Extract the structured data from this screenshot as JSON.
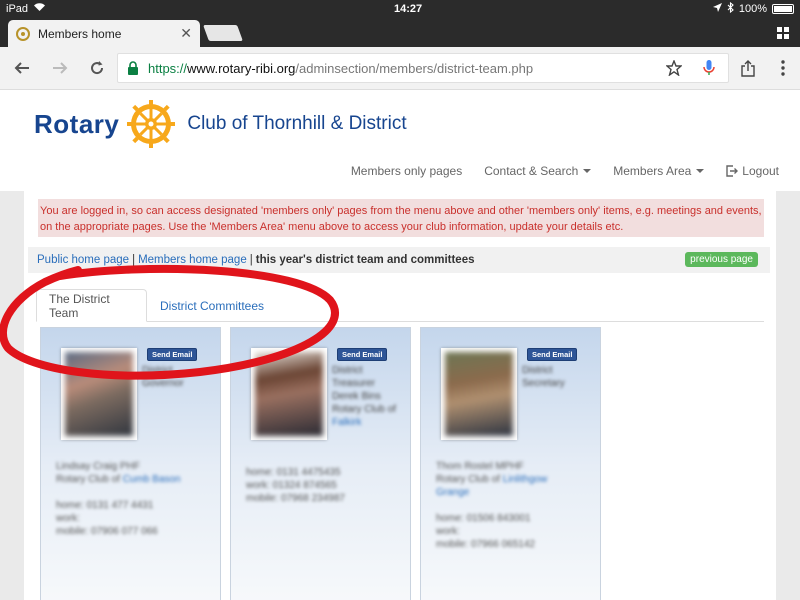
{
  "status_bar": {
    "device": "iPad",
    "time": "14:27",
    "battery": "100%",
    "battery_level": 1.0
  },
  "browser": {
    "tab_title": "Members home",
    "url": {
      "scheme": "https://",
      "host": "www.rotary-ribi.org",
      "path": "/adminsection/members/district-team.php"
    }
  },
  "site": {
    "logo_text": "Rotary",
    "club_name": "Club of Thornhill & District",
    "nav": {
      "members_only": "Members only pages",
      "contact": "Contact & Search",
      "members_area": "Members Area",
      "logout": "Logout"
    }
  },
  "alert": "You are logged in, so can access designated 'members only' pages from the menu above and other 'members only' items, e.g. meetings and events, on the appropriate pages. Use the 'Members Area' menu above to access your club information, update your details etc.",
  "breadcrumb": {
    "public_home": "Public home page",
    "separator": "|",
    "members_home": "Members home page",
    "current": "this year's district team and committees",
    "previous_button": "previous page"
  },
  "tabs": {
    "district_team": "The District Team",
    "district_committees": "District Committees"
  },
  "cards": [
    {
      "email_button": "Send Email",
      "role": [
        "District",
        "Governor"
      ],
      "details": [
        {
          "text": "Lindsay Craig PHF",
          "link": ""
        },
        {
          "text": "Rotary Club of ",
          "link": "Cumb Bason"
        },
        {
          "text": "",
          "link": ""
        },
        {
          "text": "home: 0131 477 4431",
          "link": ""
        },
        {
          "text": "work:",
          "link": ""
        },
        {
          "text": "mobile: 07906 077 066",
          "link": ""
        }
      ]
    },
    {
      "email_button": "Send Email",
      "role": [
        "District",
        "Treasurer",
        "Derek Bins",
        "Rotary Club of",
        "Falkirk"
      ],
      "details": [
        {
          "text": "home: 0131 4475435",
          "link": ""
        },
        {
          "text": "work: 01324 874565",
          "link": ""
        },
        {
          "text": "mobile: 07968 234987",
          "link": ""
        }
      ]
    },
    {
      "email_button": "Send Email",
      "role": [
        "District",
        "Secretary"
      ],
      "details": [
        {
          "text": "Thom Rostel MPHF",
          "link": ""
        },
        {
          "text": "Rotary Club of ",
          "link": "Linlithgow"
        },
        {
          "text": "",
          "link": "Grange"
        },
        {
          "text": "",
          "link": ""
        },
        {
          "text": "home: 01506 843001",
          "link": ""
        },
        {
          "text": "work:",
          "link": ""
        },
        {
          "text": "mobile: 07966 065142",
          "link": ""
        }
      ]
    }
  ],
  "colors": {
    "rotary_blue": "#17458f",
    "rotary_gold": "#f7a81b",
    "annotation_red": "#e0141b",
    "alert_bg": "#f2dede",
    "alert_text": "#c9302c",
    "link": "#2a6ebb",
    "url_green": "#0b8043"
  }
}
